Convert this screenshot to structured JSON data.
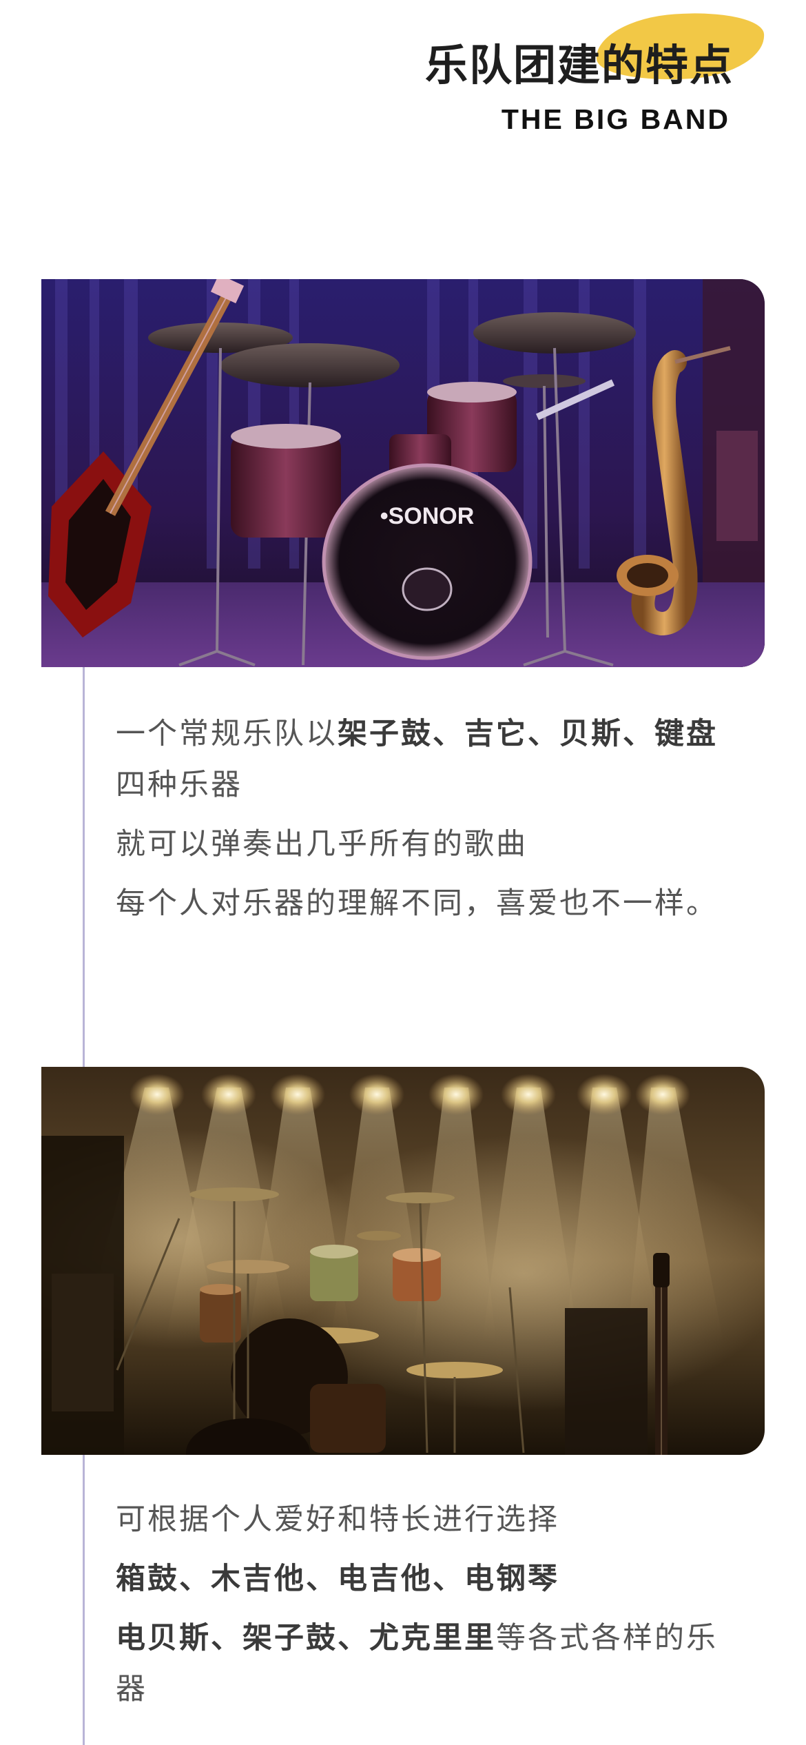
{
  "header": {
    "title": "乐队团建的特点",
    "subtitle": "THE BIG BAND"
  },
  "sections": [
    {
      "image": "drum-kit-stage-photo",
      "lines": [
        {
          "parts": [
            {
              "text": "一个常规乐队以",
              "bold": false
            },
            {
              "text": "架子鼓、吉它、贝斯、键盘",
              "bold": true
            },
            {
              "text": "四种乐器",
              "bold": false
            }
          ]
        },
        {
          "parts": [
            {
              "text": "就可以弹奏出几乎所有的歌曲",
              "bold": false
            }
          ]
        },
        {
          "parts": [
            {
              "text": "每个人对乐器的理解不同，喜爱也不一样。",
              "bold": false
            }
          ]
        }
      ]
    },
    {
      "image": "concert-stage-lights-photo",
      "lines": [
        {
          "parts": [
            {
              "text": "可根据个人爱好和特长进行选择",
              "bold": false
            }
          ]
        },
        {
          "parts": [
            {
              "text": "箱鼓、木吉他、电吉他、电钢琴",
              "bold": true
            }
          ]
        },
        {
          "parts": [
            {
              "text": "电贝斯、架子鼓、尤克里里",
              "bold": true
            },
            {
              "text": "等各式各样的乐器",
              "bold": false
            }
          ]
        }
      ]
    }
  ],
  "colors": {
    "title_highlight": "#f1c232",
    "timeline": "#b9b4d6",
    "body_text": "#555555"
  }
}
